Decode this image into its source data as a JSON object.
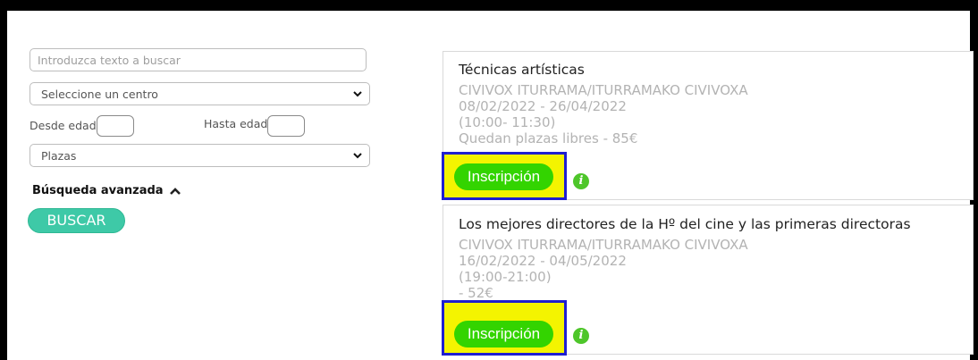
{
  "search": {
    "placeholder": "Introduzca texto a buscar",
    "center_select": "Seleccione un centro",
    "age_from_label": "Desde edad",
    "age_to_label": "Hasta edad",
    "plazas_select": "Plazas",
    "advanced_label": "Búsqueda avanzada",
    "search_button": "BUSCAR"
  },
  "courses": [
    {
      "title": "Técnicas artísticas",
      "center": "CIVIVOX ITURRAMA/ITURRAMAKO CIVIVOXA",
      "dates": "08/02/2022 - 26/04/2022",
      "time": "(10:00- 11:30)",
      "availability": "Quedan plazas libres - 85€",
      "button": "Inscripción",
      "info_icon": "i"
    },
    {
      "title": "Los mejores directores de la Hº del cine y las primeras directoras",
      "center": "CIVIVOX ITURRAMA/ITURRAMAKO CIVIVOXA",
      "dates": "16/02/2022 - 04/05/2022",
      "time": "(19:00-21:00)",
      "availability": "- 52€",
      "button": "Inscripción",
      "info_icon": "i"
    }
  ],
  "colors": {
    "search_button": "#3ec9a7",
    "inscription_button": "#33d400",
    "highlight_fill": "#f4f400",
    "highlight_border": "#1f1fd0",
    "info_icon": "#4ec62a"
  }
}
